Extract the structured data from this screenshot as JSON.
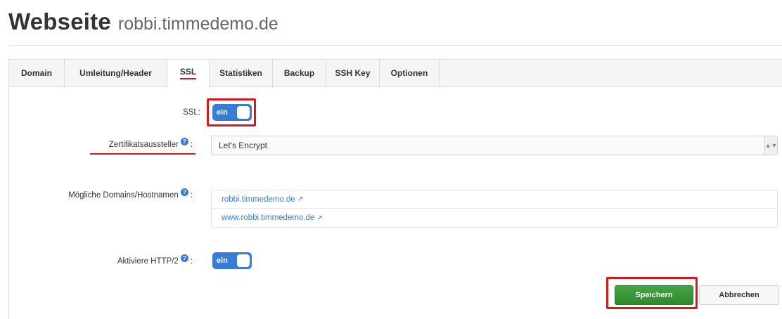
{
  "header": {
    "title": "Webseite",
    "subtitle": "robbi.timmedemo.de"
  },
  "tabs": [
    {
      "label": "Domain"
    },
    {
      "label": "Umleitung/Header"
    },
    {
      "label": "SSL",
      "active": true
    },
    {
      "label": "Statistiken"
    },
    {
      "label": "Backup"
    },
    {
      "label": "SSH Key"
    },
    {
      "label": "Optionen"
    }
  ],
  "form": {
    "ssl": {
      "label": "SSL:",
      "toggle_text": "ein",
      "on": true
    },
    "issuer": {
      "label": "Zertifikatsaussteller",
      "suffix": ":",
      "value": "Let's Encrypt"
    },
    "domains": {
      "label": "Mögliche Domains/Hostnamen",
      "suffix": ":",
      "items": [
        "robbi.timmedemo.de",
        "www.robbi.timmedemo.de"
      ]
    },
    "http2": {
      "label": "Aktiviere HTTP/2",
      "suffix": ":",
      "toggle_text": "ein",
      "on": true
    }
  },
  "buttons": {
    "save": "Speichern",
    "cancel": "Abbrechen"
  },
  "colors": {
    "accent": "#3a7bd5",
    "highlight": "#d41a1a",
    "save": "#3a9a3a"
  },
  "icons": {
    "help": "question-circle-icon",
    "external": "external-link-icon"
  }
}
